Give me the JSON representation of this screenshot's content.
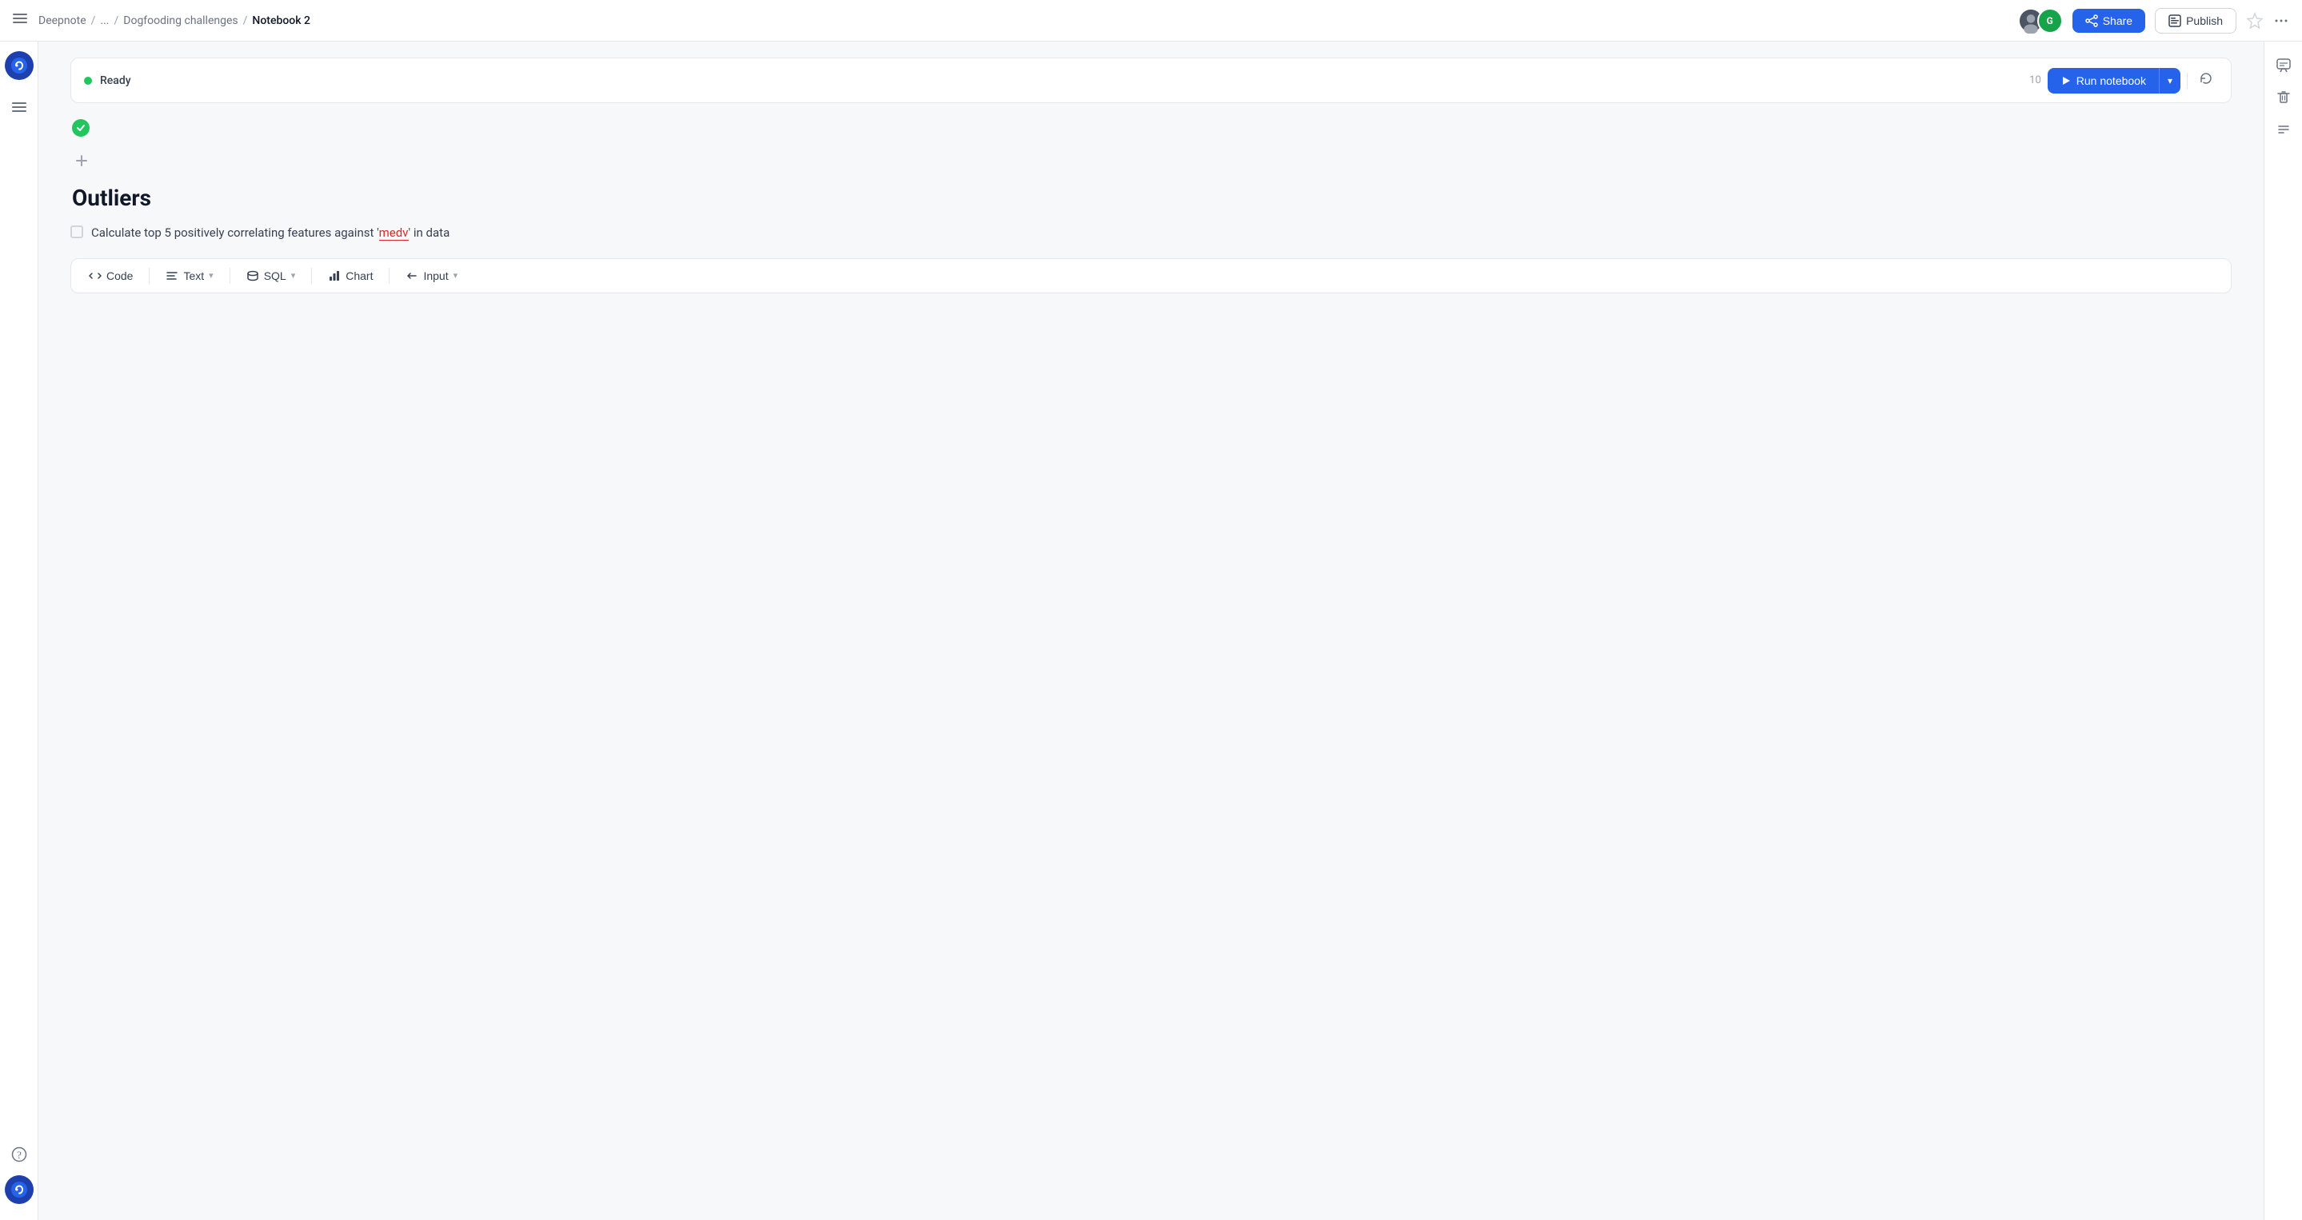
{
  "header": {
    "breadcrumb": {
      "home": "Deepnote",
      "separator1": "/",
      "ellipsis": "...",
      "separator2": "/",
      "parent": "Dogfooding challenges",
      "separator3": "/",
      "current": "Notebook 2"
    },
    "share_label": "Share",
    "publish_label": "Publish",
    "avatar_g": "G"
  },
  "toolbar": {
    "status": "Ready",
    "run_label": "Run notebook",
    "run_tooltip": "Run notebook"
  },
  "notebook": {
    "title": "Outliers",
    "task_text_before": "Calculate top 5 positively correlating features against '",
    "task_highlight": "medv",
    "task_text_after": "' in data"
  },
  "cell_types": {
    "code": "Code",
    "text": "Text",
    "text_arrow": "▾",
    "sql": "SQL",
    "sql_arrow": "▾",
    "chart": "Chart",
    "input": "Input",
    "input_arrow": "▾"
  },
  "icons": {
    "menu": "menu-icon",
    "help": "help-icon",
    "deepnote_logo": "deepnote-logo",
    "share": "share-icon",
    "publish": "publish-icon",
    "star": "star-icon",
    "more": "more-icon",
    "run": "play-icon",
    "refresh": "refresh-icon",
    "comments": "comments-icon",
    "delete": "delete-icon",
    "list": "list-icon",
    "code_icon": "code-icon",
    "text_icon": "text-icon",
    "sql_icon": "sql-icon",
    "chart_icon": "chart-icon",
    "input_icon": "input-icon"
  }
}
